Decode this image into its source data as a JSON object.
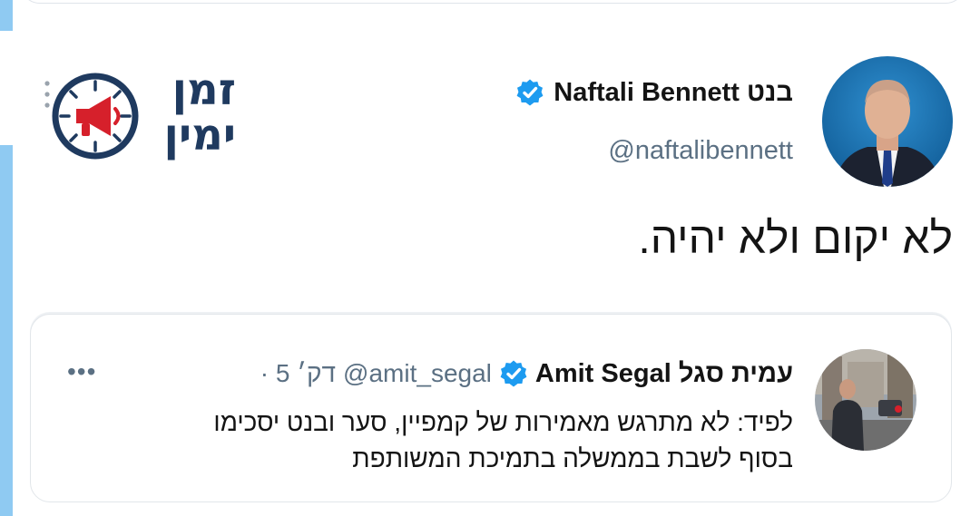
{
  "logo": {
    "line1": "זמן",
    "line2": "ימין"
  },
  "tweet": {
    "author_name": "Naftali Bennett בנט",
    "handle": "@naftalibennett",
    "verified": true,
    "text": "לא יקום ולא יהיה."
  },
  "quoted_tweet": {
    "author_name": "Amit Segal עמית סגל",
    "handle": "@amit_segal",
    "time": "· 5 דק׳",
    "more_label": "•••",
    "verified": true,
    "body_lines": [
      "לפיד: לא מתרגש מאמירות של קמפיין, סער ובנט יסכימו",
      "בסוף לשבת בממשלה בתמיכת המשותפת"
    ]
  },
  "colors": {
    "verified_blue": "#1d9bf0",
    "logo_navy": "#1f3a5f",
    "logo_red": "#d6202b",
    "secondary_text": "#5b7083",
    "accent_strip": "#8fcaf2"
  }
}
